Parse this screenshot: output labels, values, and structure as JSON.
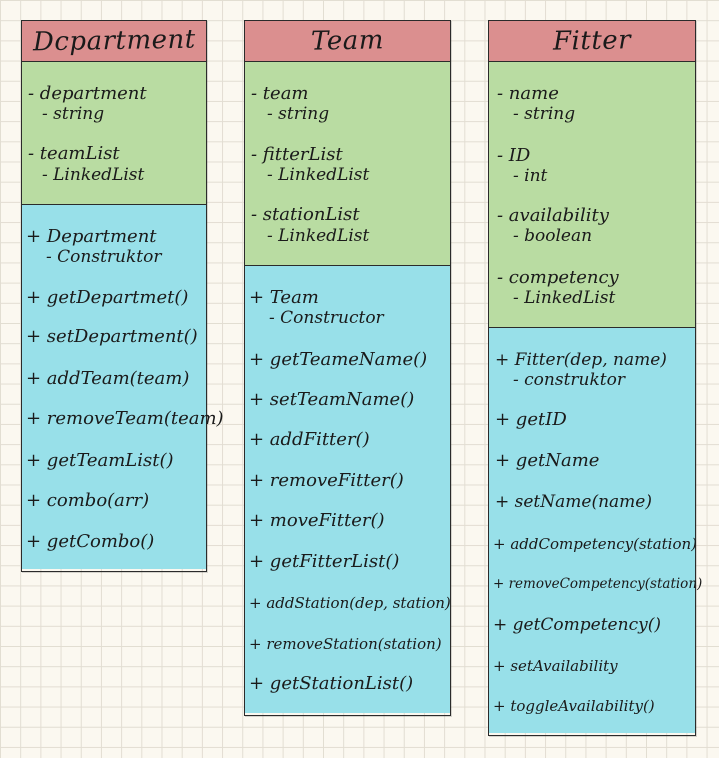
{
  "classes": {
    "department": {
      "name": "Dcpartment",
      "attributes": [
        "- department",
        "- string",
        "- teamList",
        "- LinkedList"
      ],
      "methods": [
        "+ Department",
        "- Construktor",
        "+ getDepartmet()",
        "+ setDepartment()",
        "+ addTeam(team)",
        "+ removeTeam(team)",
        "+ getTeamList()",
        "+ combo(arr)",
        "+ getCombo()"
      ]
    },
    "team": {
      "name": "Team",
      "attributes": [
        "- team",
        "- string",
        "- fitterList",
        "- LinkedList",
        "- stationList",
        "- LinkedList"
      ],
      "methods": [
        "+ Team",
        "- Constructor",
        "+ getTeameName()",
        "+ setTeamName()",
        "+ addFitter()",
        "+ removeFitter()",
        "+ moveFitter()",
        "+ getFitterList()",
        "+ addStation(dep, station)",
        "+ removeStation(station)",
        "+ getStationList()"
      ]
    },
    "fitter": {
      "name": "Fitter",
      "attributes": [
        "- name",
        "- string",
        "- ID",
        "- int",
        "- availability",
        "- boolean",
        "- competency",
        "- LinkedList"
      ],
      "methods": [
        "+ Fitter(dep, name)",
        "- construktor",
        "+ getID",
        "+ getName",
        "+ setName(name)",
        "+ addCompetency(station)",
        "+ removeCompetency(station)",
        "+ getCompetency()",
        "+ setAvailability",
        "+ toggleAvailability()"
      ]
    }
  }
}
